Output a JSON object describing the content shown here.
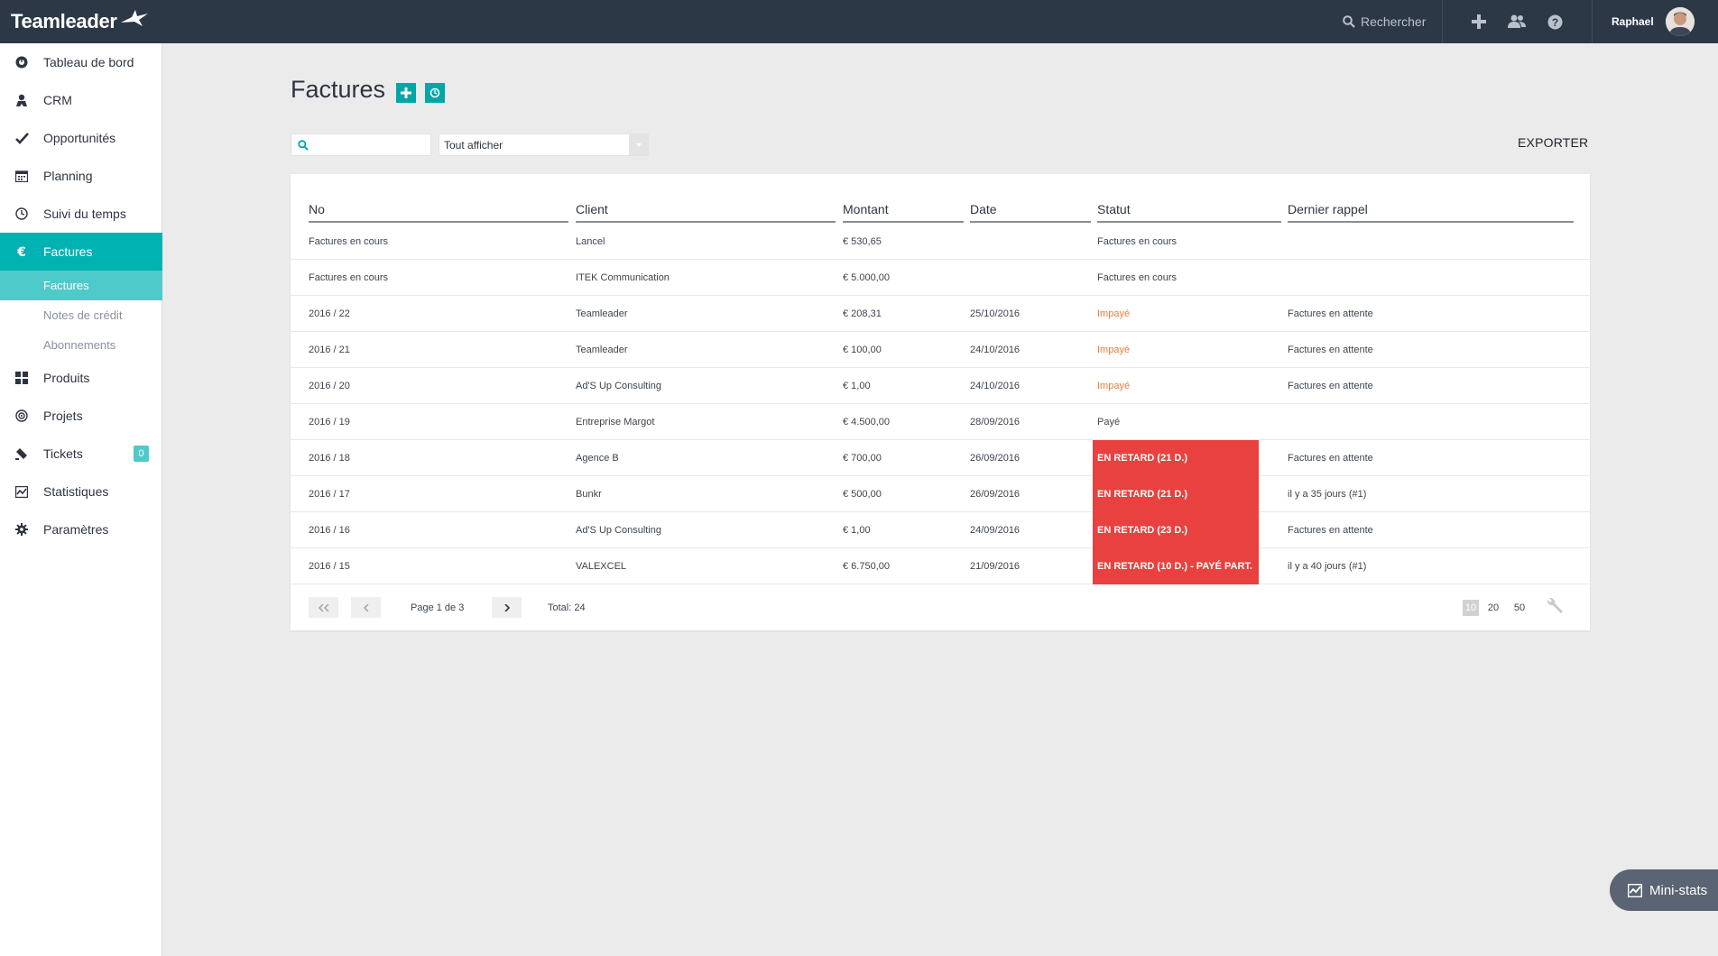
{
  "app": {
    "logo_text": "Teamleader"
  },
  "topbar": {
    "search_label": "Rechercher",
    "user_name": "Raphael",
    "icons": [
      "search-icon",
      "plus-icon",
      "users-icon",
      "help-icon"
    ]
  },
  "sidebar": {
    "items": [
      {
        "label": "Tableau de bord",
        "icon": "dashboard-icon"
      },
      {
        "label": "CRM",
        "icon": "contact-icon"
      },
      {
        "label": "Opportunités",
        "icon": "check-icon"
      },
      {
        "label": "Planning",
        "icon": "calendar-icon"
      },
      {
        "label": "Suivi du temps",
        "icon": "clock-icon"
      },
      {
        "label": "Factures",
        "icon": "euro-icon"
      },
      {
        "label": "Produits",
        "icon": "grid-icon"
      },
      {
        "label": "Projets",
        "icon": "target-icon"
      },
      {
        "label": "Tickets",
        "icon": "ticket-icon",
        "badge": "0"
      },
      {
        "label": "Statistiques",
        "icon": "chart-icon"
      },
      {
        "label": "Paramètres",
        "icon": "gear-icon"
      }
    ],
    "subitems": [
      {
        "label": "Factures"
      },
      {
        "label": "Notes de crédit"
      },
      {
        "label": "Abonnements"
      }
    ]
  },
  "page": {
    "title": "Factures",
    "search_value": "",
    "filter_value": "Tout afficher",
    "export_label": "EXPORTER"
  },
  "table": {
    "headers": [
      "No",
      "Client",
      "Montant",
      "Date",
      "Statut",
      "Dernier rappel"
    ],
    "rows": [
      {
        "no": "Factures en cours",
        "client": "Lancel",
        "amount": "€ 530,65",
        "date": "",
        "status": "Factures en cours",
        "status_type": "normal",
        "reminder": ""
      },
      {
        "no": "Factures en cours",
        "client": "ITEK Communication",
        "amount": "€ 5.000,00",
        "date": "",
        "status": "Factures en cours",
        "status_type": "normal",
        "reminder": ""
      },
      {
        "no": "2016 / 22",
        "client": "Teamleader",
        "amount": "€ 208,31",
        "date": "25/10/2016",
        "status": "Impayé",
        "status_type": "unpaid",
        "reminder": "Factures en attente"
      },
      {
        "no": "2016 / 21",
        "client": "Teamleader",
        "amount": "€ 100,00",
        "date": "24/10/2016",
        "status": "Impayé",
        "status_type": "unpaid",
        "reminder": "Factures en attente"
      },
      {
        "no": "2016 / 20",
        "client": "Ad'S Up Consulting",
        "amount": "€ 1,00",
        "date": "24/10/2016",
        "status": "Impayé",
        "status_type": "unpaid",
        "reminder": "Factures en attente"
      },
      {
        "no": "2016 / 19",
        "client": "Entreprise Margot",
        "amount": "€ 4.500,00",
        "date": "28/09/2016",
        "status": "Payé",
        "status_type": "normal",
        "reminder": ""
      },
      {
        "no": "2016 / 18",
        "client": "Agence B",
        "amount": "€ 700,00",
        "date": "26/09/2016",
        "status": "EN RETARD (21 D.)",
        "status_type": "late",
        "reminder": "Factures en attente"
      },
      {
        "no": "2016 / 17",
        "client": "Bunkr",
        "amount": "€ 500,00",
        "date": "26/09/2016",
        "status": "EN RETARD (21 D.)",
        "status_type": "late",
        "reminder": "il y a 35 jours (#1)"
      },
      {
        "no": "2016 / 16",
        "client": "Ad'S Up Consulting",
        "amount": "€ 1,00",
        "date": "24/09/2016",
        "status": "EN RETARD (23 D.)",
        "status_type": "late",
        "reminder": "Factures en attente"
      },
      {
        "no": "2016 / 15",
        "client": "VALEXCEL",
        "amount": "€ 6.750,00",
        "date": "21/09/2016",
        "status": "EN RETARD (10 D.) - PAYÉ PART.",
        "status_type": "late",
        "reminder": "il y a 40 jours (#1)"
      }
    ]
  },
  "pagination": {
    "page_text": "Page 1 de 3",
    "total_text": "Total: 24",
    "per_page_options": [
      "10",
      "20",
      "50"
    ],
    "selected_per_page": "10"
  },
  "ministats": {
    "label": "Mini-stats"
  },
  "colors": {
    "topbar": "#2d3847",
    "accent": "#00b2b2",
    "accent_light": "#4fcaca",
    "late": "#e8413f",
    "unpaid": "#f07b3f"
  }
}
